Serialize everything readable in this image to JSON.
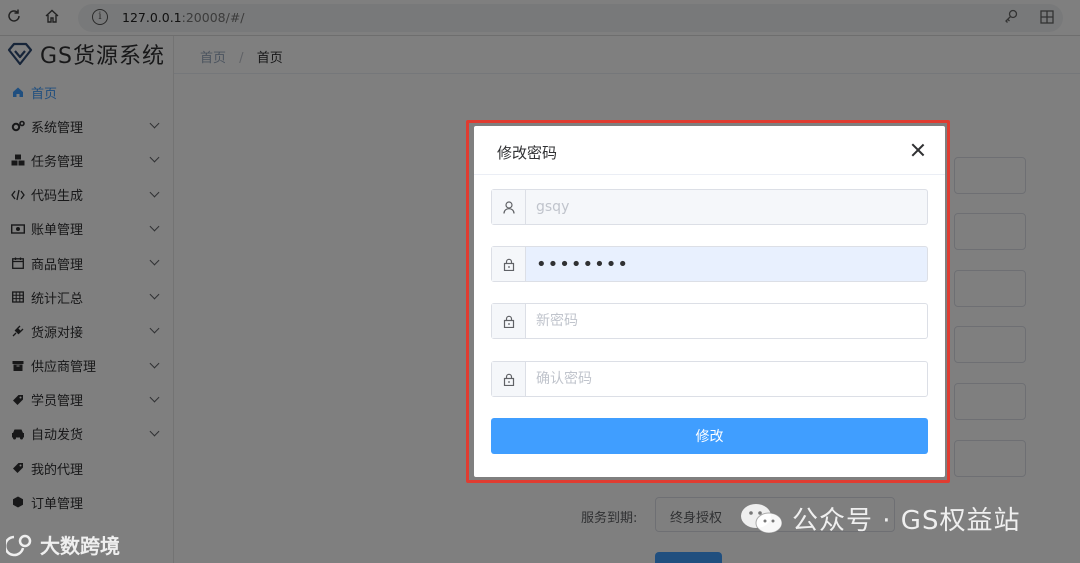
{
  "browser": {
    "url_host": "127.0.0.1",
    "url_rest": ":20008/#/"
  },
  "app": {
    "logo_text": "GS货源系统"
  },
  "sidebar": {
    "items": [
      {
        "label": "首页",
        "icon": "home-icon",
        "active": true
      },
      {
        "label": "系统管理",
        "icon": "gears-icon"
      },
      {
        "label": "任务管理",
        "icon": "cubes-icon"
      },
      {
        "label": "代码生成",
        "icon": "code-icon"
      },
      {
        "label": "账单管理",
        "icon": "money-bill-icon"
      },
      {
        "label": "商品管理",
        "icon": "calendar-icon"
      },
      {
        "label": "统计汇总",
        "icon": "table-icon"
      },
      {
        "label": "货源对接",
        "icon": "plug-icon"
      },
      {
        "label": "供应商管理",
        "icon": "archive-icon"
      },
      {
        "label": "学员管理",
        "icon": "tag-icon"
      },
      {
        "label": "自动发货",
        "icon": "car-icon"
      },
      {
        "label": "我的代理",
        "icon": "tag-icon"
      },
      {
        "label": "订单管理",
        "icon": "cube-icon"
      }
    ]
  },
  "breadcrumb": {
    "first": "首页",
    "separator": "/",
    "current": "首页"
  },
  "background_form": {
    "service_label": "服务到期:",
    "service_value": "终身授权"
  },
  "dialog": {
    "title": "修改密码",
    "username_value": "gsqy",
    "old_password_masked": "••••••••",
    "new_password_placeholder": "新密码",
    "confirm_password_placeholder": "确认密码",
    "submit_label": "修改"
  },
  "watermarks": {
    "right": "公众号 · GS权益站",
    "left": "大数跨境"
  },
  "colors": {
    "primary": "#409eff",
    "highlight_border": "#e03c31"
  }
}
